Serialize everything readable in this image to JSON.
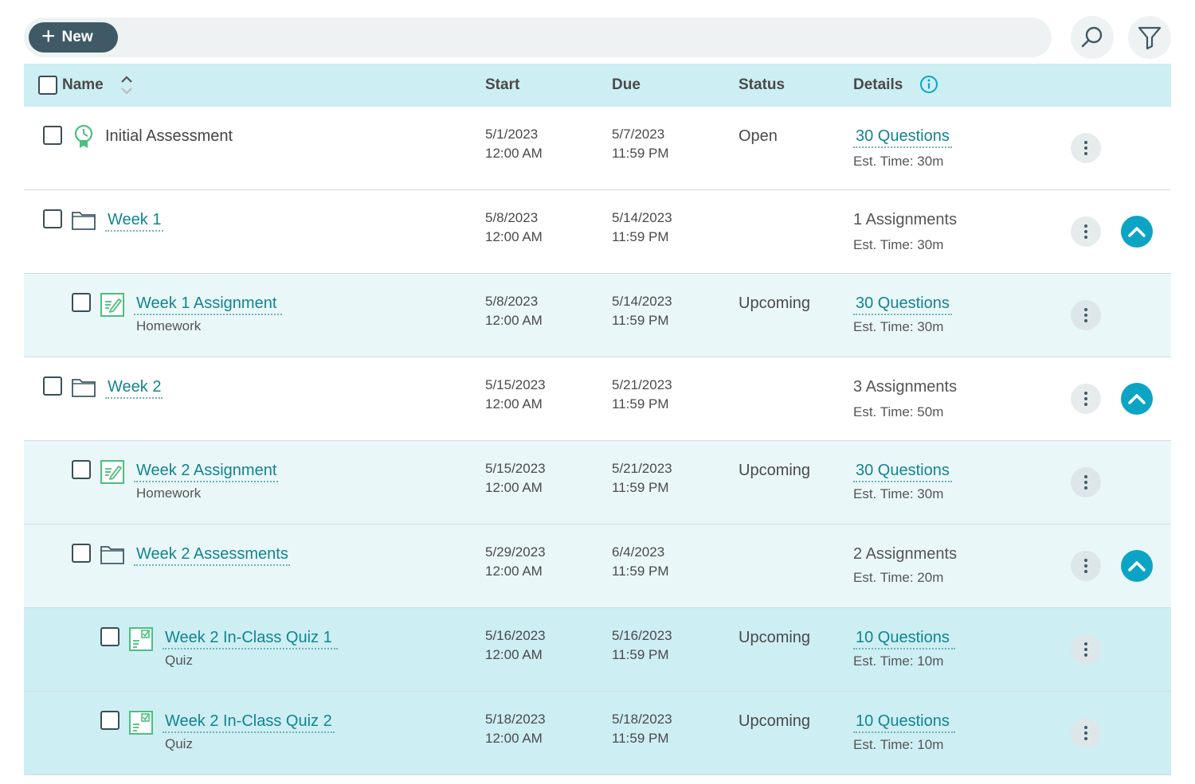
{
  "toolbar": {
    "new_label": "New",
    "search_icon": "search-icon",
    "filter_icon": "filter-icon"
  },
  "header": {
    "name": "Name",
    "start": "Start",
    "due": "Due",
    "status": "Status",
    "details": "Details"
  },
  "colors": {
    "accent": "#11858f",
    "header_bg": "#cdeef3",
    "collapse_button": "#0ca4c4",
    "new_button": "#3f5a66"
  },
  "rows": [
    {
      "kind": "assessment",
      "icon": "badge-icon",
      "name": "Initial Assessment",
      "start_date": "5/1/2023",
      "start_time": "12:00 AM",
      "due_date": "5/7/2023",
      "due_time": "11:59 PM",
      "status": "Open",
      "details": "30 Questions",
      "est": "Est. Time: 30m"
    },
    {
      "kind": "folder",
      "icon": "folder-icon",
      "name": "Week 1",
      "start_date": "5/8/2023",
      "start_time": "12:00 AM",
      "due_date": "5/14/2023",
      "due_time": "11:59 PM",
      "details": "1 Assignments",
      "est": "Est. Time: 30m"
    },
    {
      "kind": "homework",
      "icon": "homework-icon",
      "name": "Week 1 Assignment",
      "subtype": "Homework",
      "start_date": "5/8/2023",
      "start_time": "12:00 AM",
      "due_date": "5/14/2023",
      "due_time": "11:59 PM",
      "status": "Upcoming",
      "details": "30 Questions",
      "est": "Est. Time: 30m"
    },
    {
      "kind": "folder",
      "icon": "folder-icon",
      "name": "Week 2",
      "start_date": "5/15/2023",
      "start_time": "12:00 AM",
      "due_date": "5/21/2023",
      "due_time": "11:59 PM",
      "details": "3 Assignments",
      "est": "Est. Time: 50m"
    },
    {
      "kind": "homework",
      "icon": "homework-icon",
      "name": "Week 2 Assignment",
      "subtype": "Homework",
      "start_date": "5/15/2023",
      "start_time": "12:00 AM",
      "due_date": "5/21/2023",
      "due_time": "11:59 PM",
      "status": "Upcoming",
      "details": "30 Questions",
      "est": "Est. Time: 30m"
    },
    {
      "kind": "folder",
      "icon": "folder-icon",
      "name": "Week 2 Assessments",
      "start_date": "5/29/2023",
      "start_time": "12:00 AM",
      "due_date": "6/4/2023",
      "due_time": "11:59 PM",
      "details": "2 Assignments",
      "est": "Est. Time: 20m"
    },
    {
      "kind": "quiz",
      "icon": "quiz-icon",
      "name": "Week 2 In-Class Quiz 1",
      "subtype": "Quiz",
      "start_date": "5/16/2023",
      "start_time": "12:00 AM",
      "due_date": "5/16/2023",
      "due_time": "11:59 PM",
      "status": "Upcoming",
      "details": "10 Questions",
      "est": "Est. Time: 10m"
    },
    {
      "kind": "quiz",
      "icon": "quiz-icon",
      "name": "Week 2 In-Class Quiz 2",
      "subtype": "Quiz",
      "start_date": "5/18/2023",
      "start_time": "12:00 AM",
      "due_date": "5/18/2023",
      "due_time": "11:59 PM",
      "status": "Upcoming",
      "details": "10 Questions",
      "est": "Est. Time: 10m"
    }
  ]
}
